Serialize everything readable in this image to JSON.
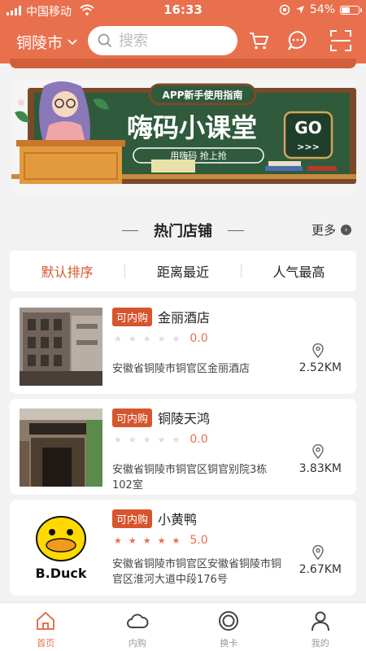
{
  "status": {
    "carrier": "中国移动",
    "time": "16:33",
    "battery": "54%",
    "battery_level": 0.54
  },
  "header": {
    "city": "铜陵市",
    "search_placeholder": "搜索"
  },
  "promo": {
    "top": "APP新手使用指南",
    "title": "嗨码小课堂",
    "subtitle": "用嗨码  抢上抢",
    "go": "GO"
  },
  "section": {
    "title": "热门店铺",
    "more": "更多"
  },
  "sort": {
    "items": [
      "默认排序",
      "距离最近",
      "人气最高"
    ],
    "active_index": 0
  },
  "shops": [
    {
      "tag": "可内购",
      "name": "金丽酒店",
      "rating": "0.0",
      "stars": 0,
      "address": "安徽省铜陵市铜官区金丽酒店",
      "distance": "2.52KM"
    },
    {
      "tag": "可内购",
      "name": "铜陵天鸿",
      "rating": "0.0",
      "stars": 0,
      "address": "安徽省铜陵市铜官区铜官别院3栋102室",
      "distance": "3.83KM"
    },
    {
      "tag": "可内购",
      "name": "小黄鸭",
      "rating": "5.0",
      "stars": 5,
      "address": "安徽省铜陵市铜官区安徽省铜陵市铜官区淮河大道中段176号",
      "distance": "2.67KM",
      "logo_text": "B.Duck"
    }
  ],
  "tabs": [
    {
      "label": "首页",
      "icon": "home-icon",
      "active": true
    },
    {
      "label": "内购",
      "icon": "cloud-icon",
      "active": false
    },
    {
      "label": "换卡",
      "icon": "ring-icon",
      "active": false
    },
    {
      "label": "我的",
      "icon": "person-icon",
      "active": false
    }
  ],
  "colors": {
    "accent": "#e8704d",
    "tag": "#d7552d",
    "chalkboard": "#2f5a3c"
  }
}
